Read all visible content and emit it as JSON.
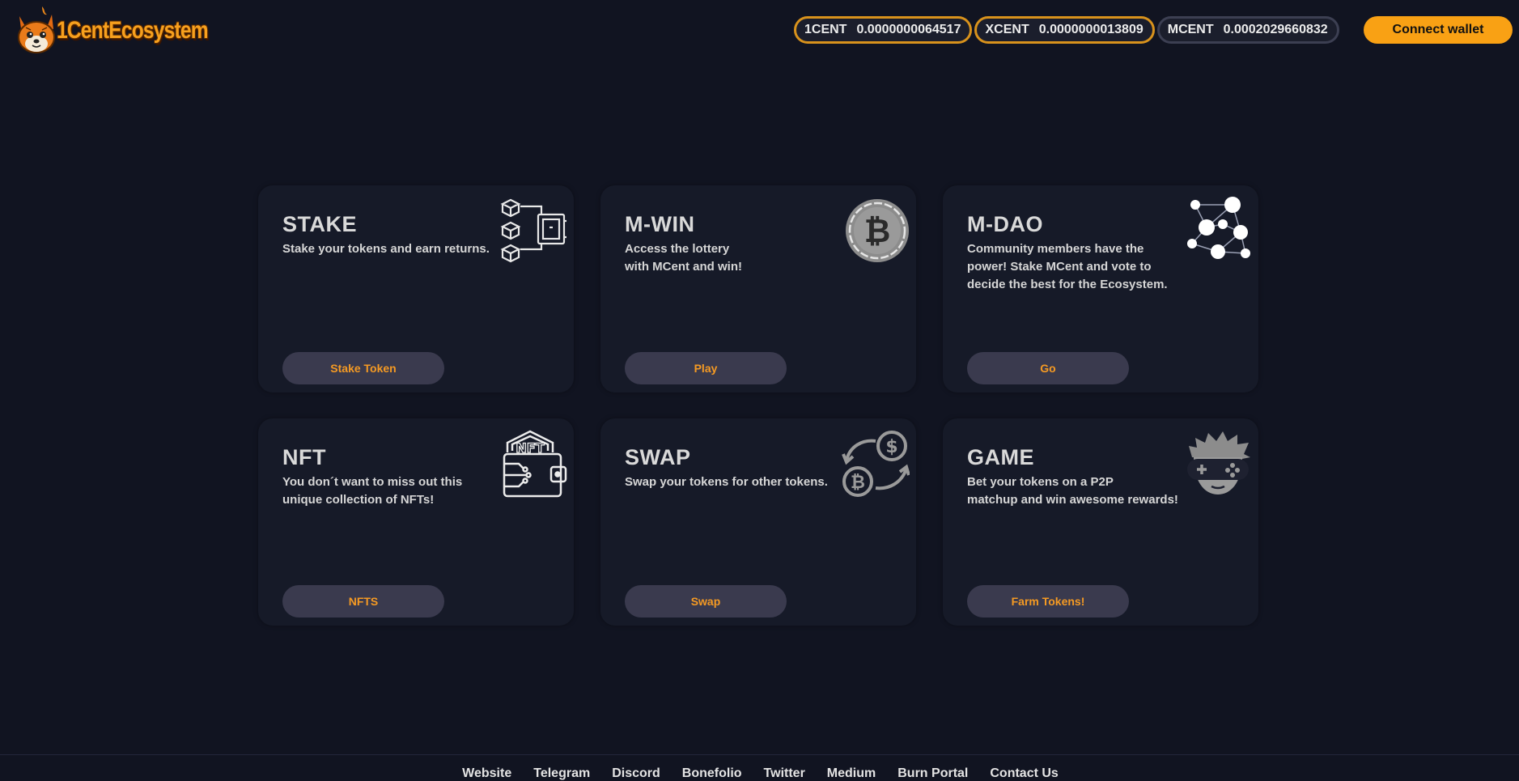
{
  "header": {
    "logo_text": "1CentEcosystem",
    "prices": [
      {
        "symbol": "1CENT",
        "value": "0.0000000064517"
      },
      {
        "symbol": "XCENT",
        "value": "0.0000000013809"
      },
      {
        "symbol": "MCENT",
        "value": "0.0002029660832"
      }
    ],
    "connect_label": "Connect wallet"
  },
  "cards": [
    {
      "title": "STAKE",
      "description": "Stake your tokens and earn returns.",
      "button": "Stake Token",
      "icon": "blockchain-safe-icon"
    },
    {
      "title": "M-WIN",
      "description": "Access the lottery\nwith MCent and win!",
      "button": "Play",
      "icon": "bitcoin-coin-icon"
    },
    {
      "title": "M-DAO",
      "description": "Community members have the power! Stake MCent and vote to decide the best for the Ecosystem.",
      "button": "Go",
      "icon": "network-nodes-icon"
    },
    {
      "title": "NFT",
      "description": "You don´t want to miss out this unique collection of NFTs!",
      "button": "NFTS",
      "icon": "nft-wallet-icon"
    },
    {
      "title": "SWAP",
      "description": "Swap your tokens for other tokens.",
      "button": "Swap",
      "icon": "currency-swap-icon"
    },
    {
      "title": "GAME",
      "description": "Bet your tokens on a P2P\nmatchup and win awesome rewards!",
      "button": "Farm Tokens!",
      "icon": "gamer-face-icon"
    }
  ],
  "footer": {
    "links": [
      "Website",
      "Telegram",
      "Discord",
      "Bonefolio",
      "Twitter",
      "Medium",
      "Burn Portal",
      "Contact Us"
    ]
  },
  "colors": {
    "background": "#111421",
    "card": "#161a28",
    "accent": "#f9a114",
    "button": "#3a3a4e"
  }
}
